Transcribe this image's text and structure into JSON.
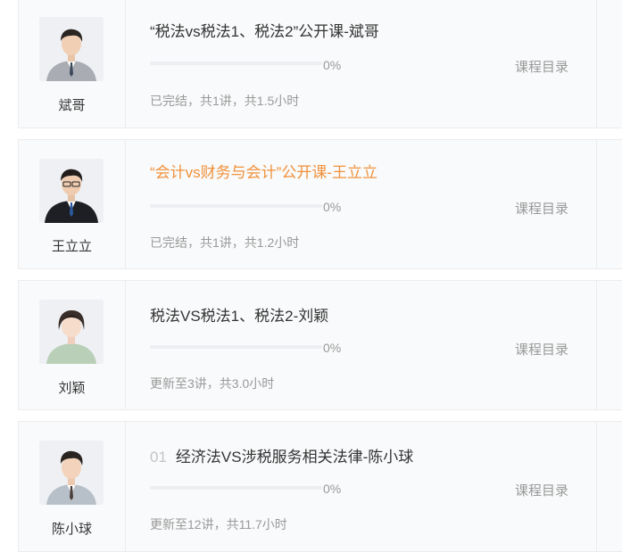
{
  "courses": [
    {
      "teacher": "斌哥",
      "index": "",
      "title": "“税法vs税法1、税法2”公开课-斌哥",
      "active": false,
      "progress_percent": 0,
      "progress_label": "0%",
      "catalog_label": "课程目录",
      "meta": "已完结，共1讲，共1.5小时"
    },
    {
      "teacher": "王立立",
      "index": "",
      "title": "“会计vs财务与会计”公开课-王立立",
      "active": true,
      "progress_percent": 0,
      "progress_label": "0%",
      "catalog_label": "课程目录",
      "meta": "已完结，共1讲，共1.2小时"
    },
    {
      "teacher": "刘颖",
      "index": "",
      "title": "税法VS税法1、税法2-刘颖",
      "active": false,
      "progress_percent": 0,
      "progress_label": "0%",
      "catalog_label": "课程目录",
      "meta": "更新至3讲，共3.0小时"
    },
    {
      "teacher": "陈小球",
      "index": "01",
      "title": "经济法VS涉税服务相关法律-陈小球",
      "active": false,
      "progress_percent": 0,
      "progress_label": "0%",
      "catalog_label": "课程目录",
      "meta": "更新至12讲，共11.7小时"
    }
  ],
  "colors": {
    "accent": "#f0913a",
    "card_bg": "#f9fafb",
    "text": "#333333",
    "muted": "#999999"
  }
}
